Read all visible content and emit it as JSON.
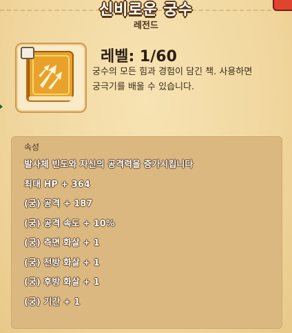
{
  "header": {
    "title": "신비로운 궁수",
    "rarity": "레전드"
  },
  "item": {
    "icon": "magic-book-icon",
    "badge_icon": "lock-badge-icon",
    "level_text": "레벨: 1/60",
    "description": "궁수의 모든 힘과 경험이 담긴 책. 사용하면\n궁극기를 배울 수 있습니다."
  },
  "attributes": {
    "header": "속성",
    "items": [
      "발사체 빈도와 자신의 공격력을 증가시킵니다",
      "최대 HP + 364",
      "(궁) 공격 + 187",
      "(궁) 공격 속도 + 10%",
      "(궁) 측면 화살 + 1",
      "(궁) 전방 화살 + 1",
      "(궁) 후방 화살 + 1",
      "(궁) 기간 + 1"
    ]
  },
  "colors": {
    "background": "#f3dba4",
    "attribute_box": "#dcb881",
    "book": "#e8a22b",
    "close_button": "#e0442f"
  }
}
